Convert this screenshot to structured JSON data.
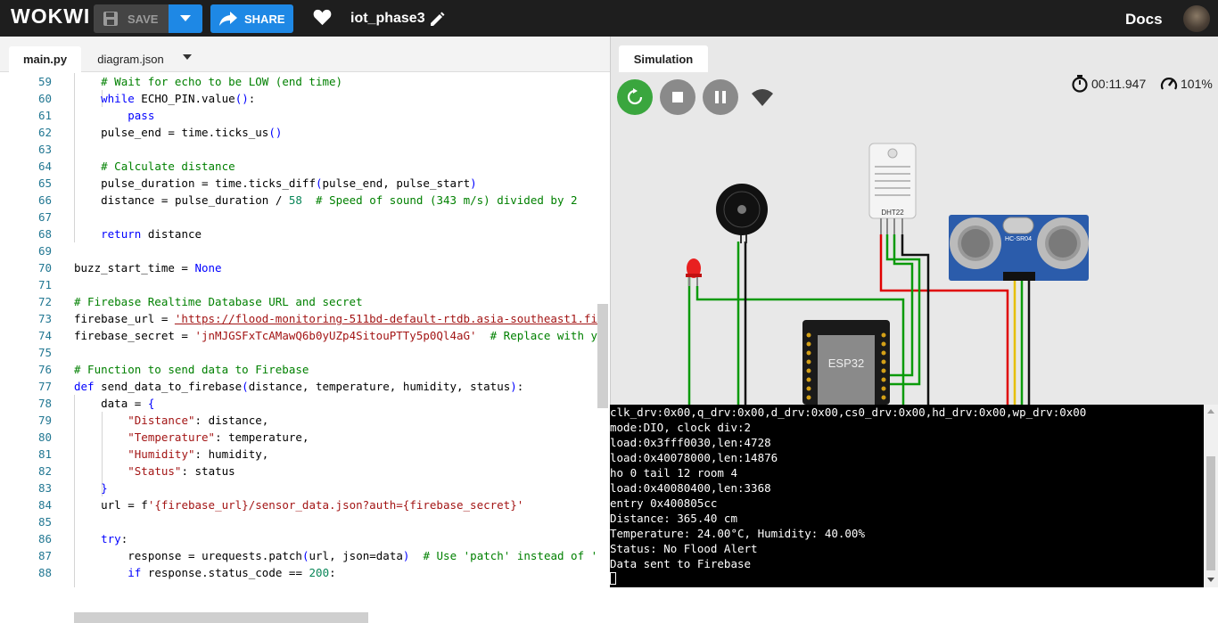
{
  "topbar": {
    "logo": "WOKWI",
    "save_label": "SAVE",
    "share_label": "SHARE",
    "project_name": "iot_phase3",
    "docs_label": "Docs",
    "colors": {
      "bar": "#1e1e1e",
      "accent": "#1e88e5"
    }
  },
  "editor": {
    "tabs": [
      "main.py",
      "diagram.json"
    ],
    "active_tab": "main.py",
    "lines": [
      {
        "n": "59",
        "text": "    # Wait for echo to be LOW (end time)"
      },
      {
        "n": "60",
        "text": "    while ECHO_PIN.value():"
      },
      {
        "n": "61",
        "text": "        pass"
      },
      {
        "n": "62",
        "text": "    pulse_end = time.ticks_us()"
      },
      {
        "n": "63",
        "text": ""
      },
      {
        "n": "64",
        "text": "    # Calculate distance"
      },
      {
        "n": "65",
        "text": "    pulse_duration = time.ticks_diff(pulse_end, pulse_start)"
      },
      {
        "n": "66",
        "text": "    distance = pulse_duration / 58  # Speed of sound (343 m/s) divided by 2"
      },
      {
        "n": "67",
        "text": ""
      },
      {
        "n": "68",
        "text": "    return distance"
      },
      {
        "n": "69",
        "text": ""
      },
      {
        "n": "70",
        "text": "buzz_start_time = None"
      },
      {
        "n": "71",
        "text": ""
      },
      {
        "n": "72",
        "text": "# Firebase Realtime Database URL and secret"
      },
      {
        "n": "73",
        "text": "firebase_url = 'https://flood-monitoring-511bd-default-rtdb.asia-southeast1.fi"
      },
      {
        "n": "74",
        "text": "firebase_secret = 'jnMJGSFxTcAMawQ6b0yUZp4SitouPTTy5p0Ql4aG'  # Replace with y"
      },
      {
        "n": "75",
        "text": ""
      },
      {
        "n": "76",
        "text": "# Function to send data to Firebase"
      },
      {
        "n": "77",
        "text": "def send_data_to_firebase(distance, temperature, humidity, status):"
      },
      {
        "n": "78",
        "text": "    data = {"
      },
      {
        "n": "79",
        "text": "        \"Distance\": distance,"
      },
      {
        "n": "80",
        "text": "        \"Temperature\": temperature,"
      },
      {
        "n": "81",
        "text": "        \"Humidity\": humidity,"
      },
      {
        "n": "82",
        "text": "        \"Status\": status"
      },
      {
        "n": "83",
        "text": "    }"
      },
      {
        "n": "84",
        "text": "    url = f'{firebase_url}/sensor_data.json?auth={firebase_secret}'"
      },
      {
        "n": "85",
        "text": ""
      },
      {
        "n": "86",
        "text": "    try:"
      },
      {
        "n": "87",
        "text": "        response = urequests.patch(url, json=data)  # Use 'patch' instead of '"
      },
      {
        "n": "88",
        "text": "        if response.status_code == 200:"
      }
    ]
  },
  "simulation": {
    "tab_label": "Simulation",
    "timer": "00:11.947",
    "speed": "101%",
    "parts": {
      "dht": "DHT22",
      "ultrasonic": "HC-SR04",
      "mcu": "ESP32"
    }
  },
  "console": {
    "lines": [
      "clk_drv:0x00,q_drv:0x00,d_drv:0x00,cs0_drv:0x00,hd_drv:0x00,wp_drv:0x00",
      "mode:DIO, clock div:2",
      "load:0x3fff0030,len:4728",
      "load:0x40078000,len:14876",
      "ho 0 tail 12 room 4",
      "load:0x40080400,len:3368",
      "entry 0x400805cc",
      "Distance: 365.40 cm",
      "Temperature: 24.00°C, Humidity: 40.00%",
      "Status: No Flood Alert",
      "Data sent to Firebase"
    ]
  }
}
